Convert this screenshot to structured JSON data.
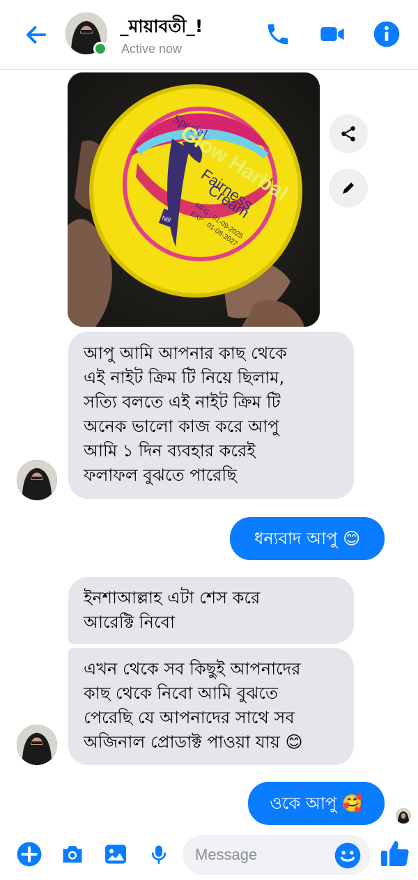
{
  "header": {
    "contact_name": "_মায়াবতী_!",
    "status": "Active now",
    "accent": "#0a7cff",
    "online_color": "#31a24c"
  },
  "icons": {
    "back": "arrow-left-icon",
    "call": "phone-icon",
    "video": "video-camera-icon",
    "info": "info-icon",
    "share": "share-icon",
    "edit": "edit-icon",
    "plus": "plus-icon",
    "camera": "camera-icon",
    "gallery": "image-icon",
    "mic": "microphone-icon",
    "emoji": "emoji-icon",
    "like": "thumbs-up-icon"
  },
  "photo": {
    "label_special": "Special",
    "label_brand": "Glow Harbal",
    "label_fairness": "Fairness",
    "label_cream": "Cream",
    "mfg": "MFG : 01-09-2025",
    "exp": "EXP : 01-08-2027",
    "logo_text": "Nill"
  },
  "messages": [
    {
      "from": "them",
      "lines": [
        "আপু আমি আপনার কাছ থেকে",
        "এই নাইট ক্রিম টি নিয়ে ছিলাম,",
        "সত্যি বলতে এই নাইট ক্রিম টি",
        "অনেক ভালো কাজ করে আপু",
        "আমি ১ দিন ব্যবহার করেই",
        "ফলাফল বুঝতে পারেছি"
      ]
    },
    {
      "from": "me",
      "text": "ধন্যবাদ আপু 😊"
    },
    {
      "from": "them",
      "lines": [
        "ইনশাআল্লাহ এটা শেস করে",
        "আরেক্টি নিবো"
      ]
    },
    {
      "from": "them",
      "lines": [
        "এখন থেকে সব কিছুই আপনাদের",
        "কাছ থেকে নিবো আমি বুঝতে",
        "পেরেছি যে আপনাদের সাথে সব",
        "অজিনাল প্রোডাক্ট পাওয়া যায় 😊"
      ]
    },
    {
      "from": "me",
      "text": "ওকে আপু 🥰"
    }
  ],
  "composer": {
    "placeholder": "Message"
  }
}
